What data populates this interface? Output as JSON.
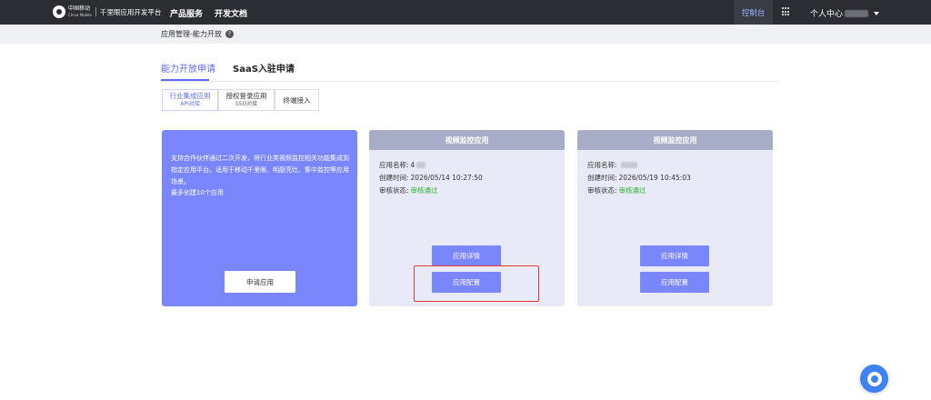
{
  "header": {
    "logo_cn": "中国移动",
    "logo_en": "China Mobile",
    "platform": "千里眼应用开发平台",
    "nav": [
      "产品服务",
      "开发文档"
    ],
    "console": "控制台",
    "user": "个人中心"
  },
  "breadcrumb": {
    "text": "应用管理-能力开放",
    "help_icon": "question-circle-icon"
  },
  "tabs": [
    {
      "label": "能力开放申请",
      "active": true
    },
    {
      "label": "SaaS入驻申请",
      "active": false
    }
  ],
  "subtabs": [
    {
      "title": "行业集成应用",
      "sub": "API对接",
      "active": true
    },
    {
      "title": "授权登录应用",
      "sub": "SSO对接",
      "active": false
    },
    {
      "title": "终端接入",
      "sub": "",
      "active": false
    }
  ],
  "apply_card": {
    "description": "支持合作伙伴通过二次开发，将行业类视频监控相关功能集成到指定应用平台。适用于移动千里眼、明厨亮灶、集中监控等应用场景。",
    "limit": "最多创建10个应用",
    "button": "申请应用"
  },
  "app_cards": [
    {
      "title": "视频监控应用",
      "name_label": "应用名称:",
      "name_value": "4",
      "created_label": "创建时间:",
      "created_value": "2026/05/14 10:27:50",
      "status_label": "审核状态:",
      "status_value": "审核通过",
      "detail_button": "应用详情",
      "config_button": "应用配置"
    },
    {
      "title": "视频监控应用",
      "name_label": "应用名称:",
      "name_value": "",
      "created_label": "创建时间:",
      "created_value": "2026/05/19 10:45:03",
      "status_label": "审核状态:",
      "status_value": "审核通过",
      "detail_button": "应用详情",
      "config_button": "应用配置"
    }
  ],
  "colors": {
    "topbar": "#2b2d33",
    "accent": "#5b6bff",
    "card_purple": "#7a86fb",
    "status_green": "#2db52d",
    "highlight_red": "#e53935"
  },
  "float_icon": "customer-service-icon"
}
